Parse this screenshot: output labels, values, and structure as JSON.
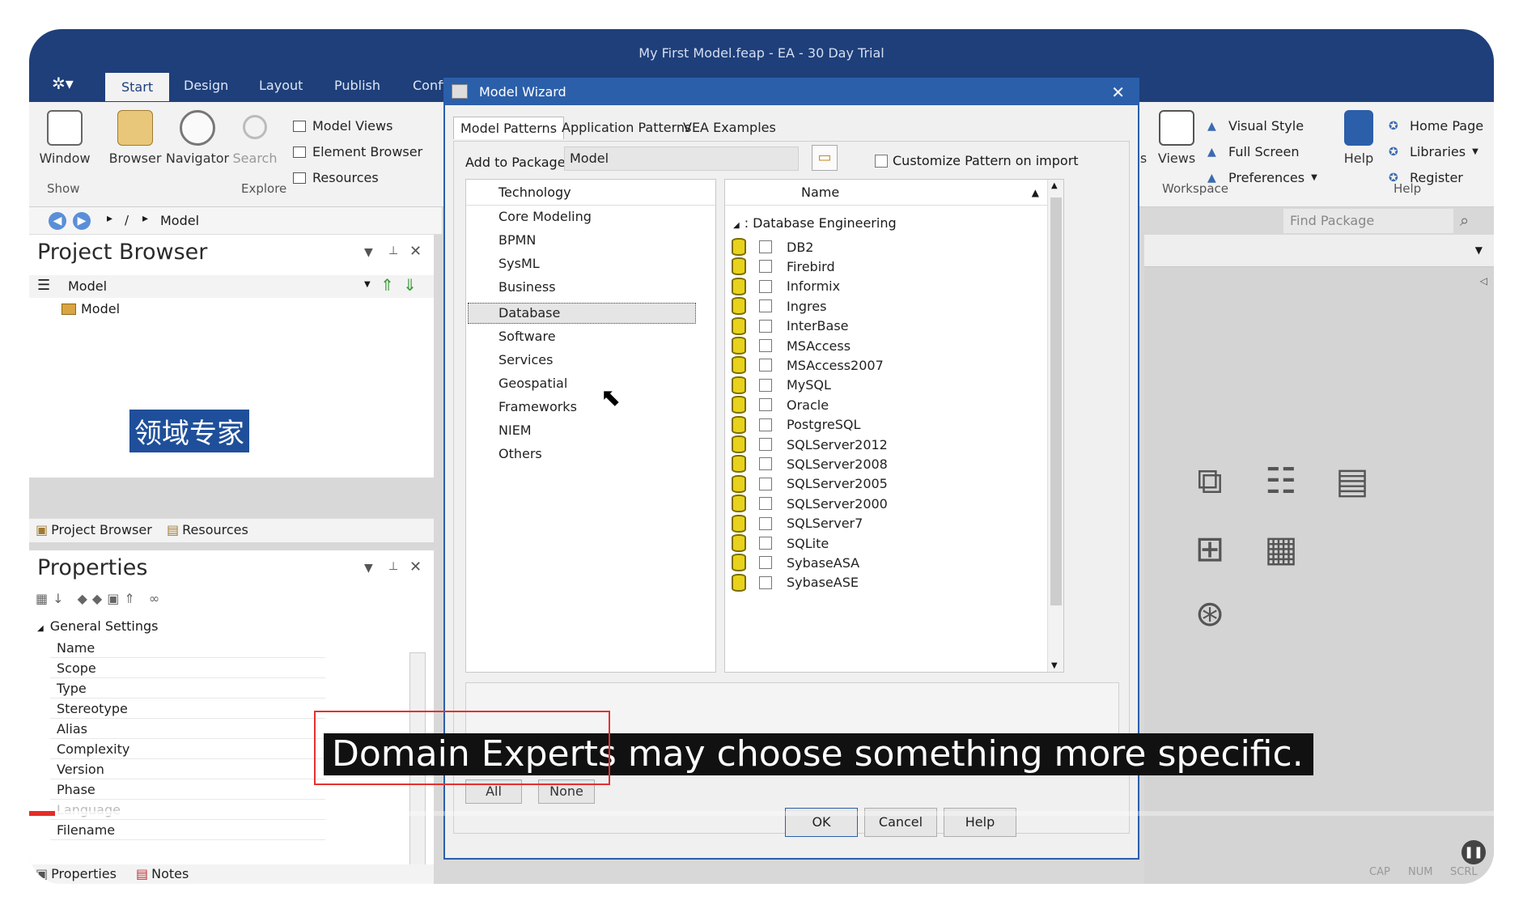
{
  "window": {
    "title": "My First Model.feap - EA - 30 Day Trial"
  },
  "ribbon_tabs": [
    "Start",
    "Design",
    "Layout",
    "Publish",
    "Confi"
  ],
  "ribbon": {
    "window_label": "Window",
    "show_group": "Show",
    "browser_label": "Browser",
    "navigator_label": "Navigator",
    "search_label": "Search",
    "model_views": "Model Views",
    "element_browser": "Element Browser",
    "resources": "Resources",
    "explore_group": "Explore",
    "workspace_partial": "s",
    "views_label": "Views",
    "visual_style": "Visual Style",
    "full_screen": "Full Screen",
    "preferences": "Preferences",
    "workspace_group": "Workspace",
    "help_label": "Help",
    "home_page": "Home Page",
    "libraries": "Libraries",
    "register": "Register",
    "help_group": "Help"
  },
  "navbar": {
    "separator": "/",
    "path": "Model"
  },
  "find_package": {
    "placeholder": "Find Package"
  },
  "project_browser": {
    "title": "Project Browser",
    "root": "Model",
    "child": "Model",
    "tabs": [
      "Project Browser",
      "Resources"
    ]
  },
  "overlay_chinese": "领域专家",
  "properties": {
    "title": "Properties",
    "section": "General Settings",
    "rows": [
      "Name",
      "Scope",
      "Type",
      "Stereotype",
      "Alias",
      "Complexity",
      "Version",
      "Phase",
      "Language",
      "Filename"
    ],
    "tabs": [
      "Properties",
      "Notes"
    ]
  },
  "dialog": {
    "title": "Model Wizard",
    "tabs": [
      "Model Patterns",
      "Application Patterns",
      "VEA Examples"
    ],
    "add_to_package_label": "Add to Package",
    "add_to_package_value": "Model",
    "customize_label": "Customize Pattern on import",
    "technology_header": "Technology",
    "technologies": [
      "Core Modeling",
      "BPMN",
      "SysML",
      "Business",
      "Database",
      "Software",
      "Services",
      "Geospatial",
      "Frameworks",
      "NIEM",
      "Others"
    ],
    "selected_technology": "Database",
    "name_header": "Name",
    "group_label": ": Database Engineering",
    "patterns": [
      "DB2",
      "Firebird",
      "Informix",
      "Ingres",
      "InterBase",
      "MSAccess",
      "MSAccess2007",
      "MySQL",
      "Oracle",
      "PostgreSQL",
      "SQLServer2012",
      "SQLServer2008",
      "SQLServer2005",
      "SQLServer2000",
      "SQLServer7",
      "SQLite",
      "SybaseASA",
      "SybaseASE"
    ],
    "all_button": "All",
    "none_button": "None",
    "ok_button": "OK",
    "cancel_button": "Cancel",
    "help_button": "Help"
  },
  "caption": {
    "text": "Domain Experts may choose something more specific."
  },
  "status_bar": [
    "CAP",
    "NUM",
    "SCRL"
  ],
  "colors": {
    "ribbon_blue": "#1e3f7a",
    "dialog_blue": "#2b5faa",
    "highlight_red": "#e53030",
    "db_yellow": "#e8d21c"
  }
}
